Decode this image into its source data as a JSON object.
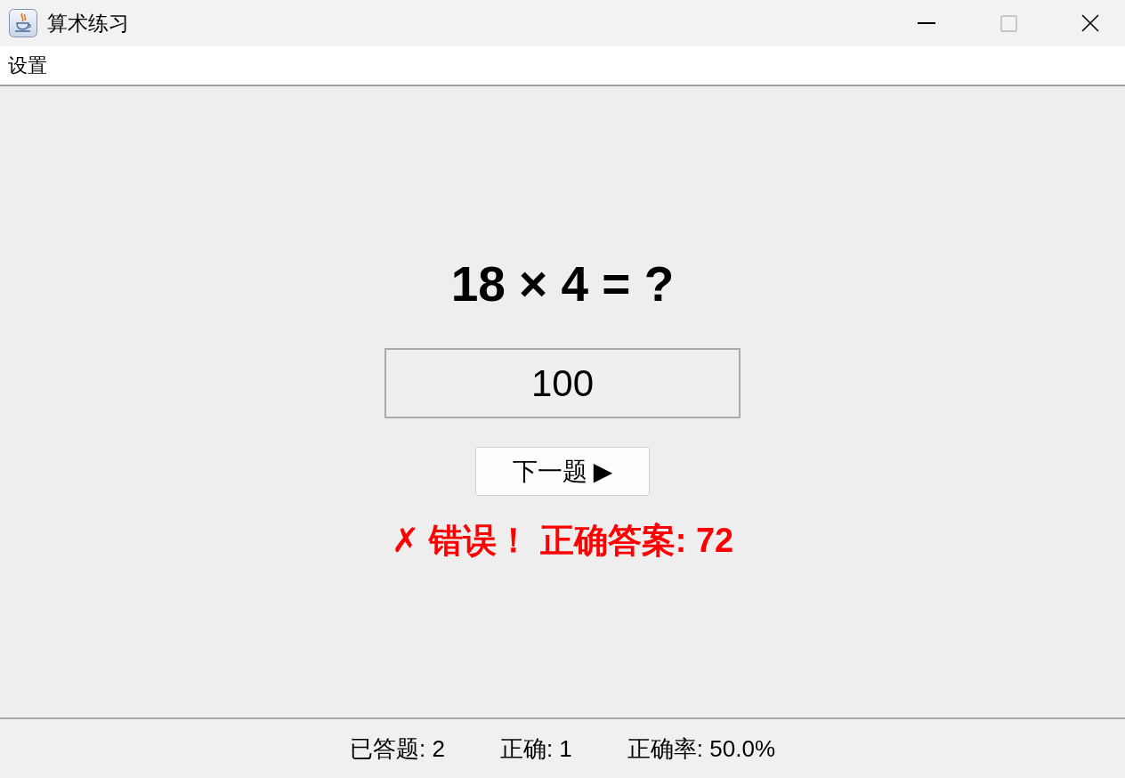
{
  "window": {
    "title": "算术练习",
    "controls": [
      {
        "kind": "minimize",
        "disabled": false
      },
      {
        "kind": "maximize",
        "disabled": true
      },
      {
        "kind": "close",
        "disabled": false
      }
    ]
  },
  "menu_bar": {
    "items": [
      "设置"
    ]
  },
  "question": "18 × 4 = ?",
  "answer_field": {
    "value": "100"
  },
  "next_button": {
    "label": "下一题 ▶"
  },
  "feedback": {
    "text": "✗ 错误！ 正确答案: 72",
    "correct": false
  },
  "status_bar": {
    "items": [
      "已答题: 2",
      "正确: 1",
      "正确率: 50.0%"
    ]
  }
}
